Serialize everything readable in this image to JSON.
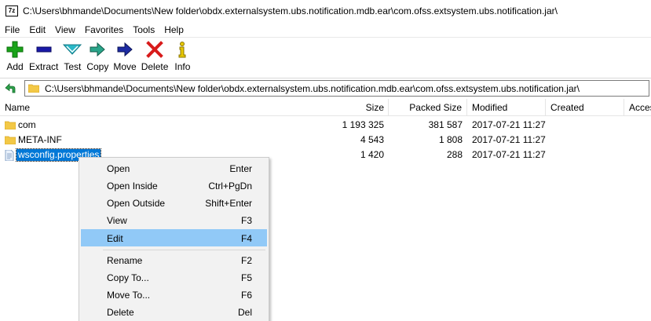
{
  "window": {
    "title": "C:\\Users\\bhmande\\Documents\\New folder\\obdx.externalsystem.ubs.notification.mdb.ear\\com.ofss.extsystem.ubs.notification.jar\\",
    "app_icon_text": "7z"
  },
  "menubar": {
    "items": [
      "File",
      "Edit",
      "View",
      "Favorites",
      "Tools",
      "Help"
    ]
  },
  "toolbar": {
    "buttons": [
      {
        "label": "Add",
        "icon": "plus-icon",
        "color": "#19a319"
      },
      {
        "label": "Extract",
        "icon": "minus-icon",
        "color": "#1a1aa8"
      },
      {
        "label": "Test",
        "icon": "check-icon",
        "color": "#2ab8c8"
      },
      {
        "label": "Copy",
        "icon": "copy-arrow-icon",
        "color": "#2aa58a"
      },
      {
        "label": "Move",
        "icon": "move-arrow-icon",
        "color": "#1d2ba3"
      },
      {
        "label": "Delete",
        "icon": "delete-x-icon",
        "color": "#d81b1b"
      },
      {
        "label": "Info",
        "icon": "info-icon",
        "color": "#e8c800"
      }
    ]
  },
  "address": {
    "path": "C:\\Users\\bhmande\\Documents\\New folder\\obdx.externalsystem.ubs.notification.mdb.ear\\com.ofss.extsystem.ubs.notification.jar\\"
  },
  "columns": {
    "name": "Name",
    "size": "Size",
    "packed": "Packed Size",
    "modified": "Modified",
    "created": "Created",
    "accessed": "Acces"
  },
  "files": [
    {
      "name": "com",
      "type": "folder",
      "size": "1 193 325",
      "packed": "381 587",
      "modified": "2017-07-21 11:27"
    },
    {
      "name": "META-INF",
      "type": "folder",
      "size": "4 543",
      "packed": "1 808",
      "modified": "2017-07-21 11:27"
    },
    {
      "name": "wsconfig.properties",
      "type": "file",
      "size": "1 420",
      "packed": "288",
      "modified": "2017-07-21 11:27",
      "selected": true
    }
  ],
  "context_menu": {
    "items": [
      {
        "label": "Open",
        "shortcut": "Enter"
      },
      {
        "label": "Open Inside",
        "shortcut": "Ctrl+PgDn"
      },
      {
        "label": "Open Outside",
        "shortcut": "Shift+Enter"
      },
      {
        "label": "View",
        "shortcut": "F3"
      },
      {
        "label": "Edit",
        "shortcut": "F4",
        "highlighted": true
      },
      {
        "label": "Rename",
        "shortcut": "F2"
      },
      {
        "label": "Copy To...",
        "shortcut": "F5"
      },
      {
        "label": "Move To...",
        "shortcut": "F6"
      },
      {
        "label": "Delete",
        "shortcut": "Del"
      }
    ]
  }
}
